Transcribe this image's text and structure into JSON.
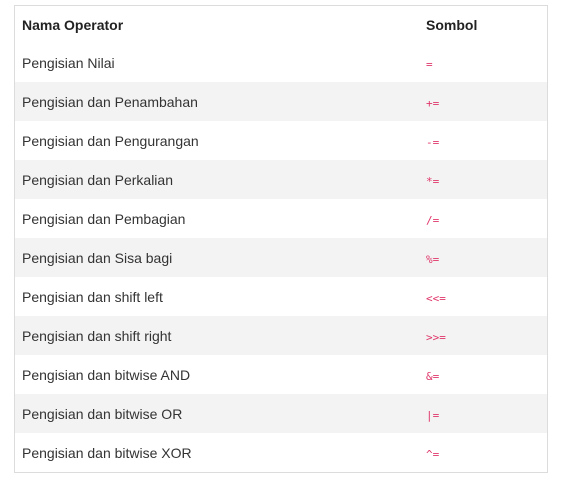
{
  "table": {
    "headers": [
      "Nama Operator",
      "Sombol"
    ],
    "rows": [
      {
        "name": "Pengisian Nilai",
        "symbol": "="
      },
      {
        "name": "Pengisian dan Penambahan",
        "symbol": "+="
      },
      {
        "name": "Pengisian dan Pengurangan",
        "symbol": "-="
      },
      {
        "name": "Pengisian dan Perkalian",
        "symbol": "*="
      },
      {
        "name": "Pengisian dan Pembagian",
        "symbol": "/="
      },
      {
        "name": "Pengisian dan Sisa bagi",
        "symbol": "%="
      },
      {
        "name": "Pengisian dan shift left",
        "symbol": "<<="
      },
      {
        "name": "Pengisian dan shift right",
        "symbol": ">>="
      },
      {
        "name": "Pengisian dan bitwise AND",
        "symbol": "&="
      },
      {
        "name": "Pengisian dan bitwise OR",
        "symbol": "|="
      },
      {
        "name": "Pengisian dan bitwise XOR",
        "symbol": "^="
      }
    ]
  },
  "colors": {
    "symbol": "#e0366a",
    "stripe": "#f3f3f3",
    "border": "#dcdcdc"
  }
}
